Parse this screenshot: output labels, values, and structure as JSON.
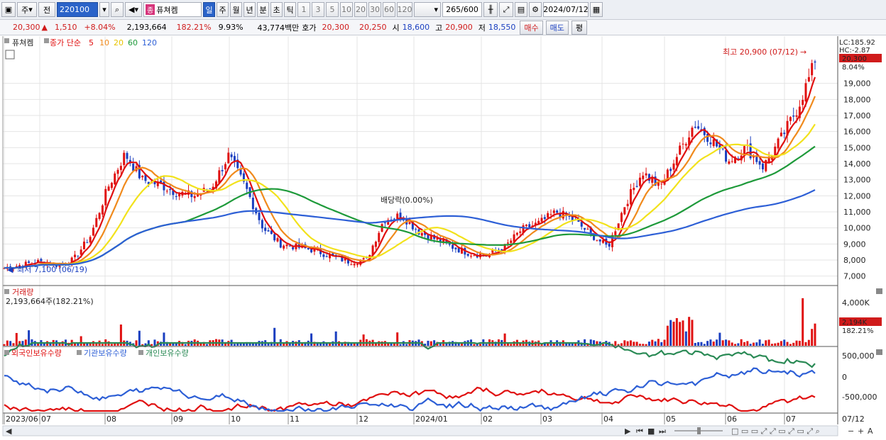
{
  "toolbar": {
    "mode1": "주",
    "mode2": "전",
    "code": "220100",
    "name_tag": "종",
    "name": "퓨쳐켐",
    "periods": [
      "일",
      "주",
      "월",
      "년",
      "분",
      "초",
      "틱"
    ],
    "intervals": [
      "1",
      "3",
      "5",
      "10",
      "20",
      "30",
      "60",
      "120"
    ],
    "count": "265",
    "count_max": "/600",
    "date": "2024/07/12"
  },
  "quote": {
    "price": "20,300",
    "change": "1,510",
    "rate": "+8.04%",
    "volume": "2,193,664",
    "vol_rate": "182.21%",
    "turnover": "9.93%",
    "amount": "43,774백만",
    "hoga_label": "호가",
    "ask": "20,300",
    "bid": "20,250",
    "open_label": "시",
    "open": "18,600",
    "high_label": "고",
    "high": "20,900",
    "low_label": "저",
    "low": "18,550",
    "buy": "매수",
    "sell": "매도",
    "eval": "평"
  },
  "price_panel": {
    "name": "퓨쳐켐",
    "legend_prefix": "종가 단순",
    "ma": [
      {
        "period": "5",
        "color": "#e01010"
      },
      {
        "period": "10",
        "color": "#f08a1c"
      },
      {
        "period": "20",
        "color": "#f2e21c"
      },
      {
        "period": "60",
        "color": "#1e9a3a"
      },
      {
        "period": "120",
        "color": "#2d5fd6"
      }
    ],
    "lc": "LC:185.92",
    "hc": "HC:-2.87",
    "last_price": "20,300",
    "last_rate": "8.04%",
    "high_note": "최고 20,900 (07/12)",
    "low_note": "최저 7,100 (06/19)",
    "dividend_note": "배당락(0.00%)",
    "y_ticks": [
      "19,000",
      "18,000",
      "17,000",
      "16,000",
      "15,000",
      "14,000",
      "13,000",
      "12,000",
      "11,000",
      "10,000",
      "9,000",
      "8,000",
      "7,000"
    ]
  },
  "volume_panel": {
    "title": "거래량",
    "value": "2,193,664주(182.21%)",
    "tick": "4,000K",
    "last": "2,194K",
    "last_rate": "182.21%"
  },
  "holding_panel": {
    "series": [
      {
        "name": "외국인보유수량",
        "color": "#e01010"
      },
      {
        "name": "기관보유수량",
        "color": "#2d5fd6"
      },
      {
        "name": "개인보유수량",
        "color": "#2a8a55"
      }
    ],
    "y_ticks": [
      "500,000",
      "0",
      "-500,000"
    ]
  },
  "x_axis": {
    "labels": [
      "2023/06",
      "07",
      "08",
      "09",
      "10",
      "11",
      "12",
      "2024/01",
      "02",
      "03",
      "04",
      "05",
      "06",
      "07"
    ],
    "right_label": "07/12"
  },
  "chart_data": {
    "type": "candlestick",
    "title": "퓨쳐켐",
    "ylim": [
      6500,
      21500
    ],
    "x": [
      "2023/06",
      "07",
      "08",
      "09",
      "10",
      "11",
      "12",
      "2024/01",
      "02",
      "03",
      "04",
      "05",
      "06",
      "07"
    ],
    "close_anchors": [
      7500,
      7700,
      7900,
      7700,
      8000,
      9500,
      12500,
      14600,
      13000,
      12700,
      12200,
      12000,
      12500,
      14500,
      12500,
      10000,
      9000,
      8800,
      8600,
      8200,
      7900,
      8000,
      10500,
      10800,
      9800,
      9300,
      8800,
      8400,
      8300,
      8800,
      9900,
      10300,
      11000,
      10500,
      9600,
      8800,
      11500,
      13500,
      12500,
      14500,
      16500,
      15500,
      14200,
      15000,
      13800,
      15500,
      17500,
      20300
    ],
    "volume_peak_k": 4000,
    "last_volume_k": 2194
  }
}
